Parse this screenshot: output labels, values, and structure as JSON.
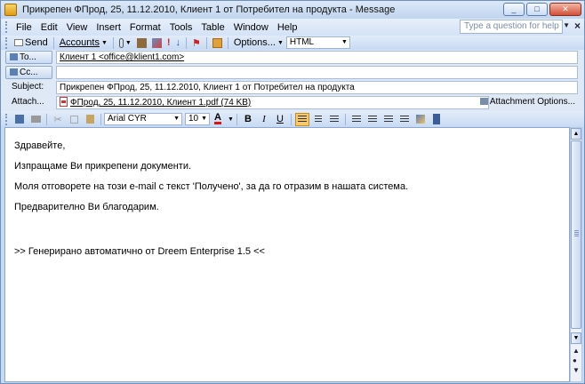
{
  "window": {
    "title": "Прикрепен ФПрод, 25, 11.12.2010, Клиент 1 от Потребител на продукта - Message",
    "controls": [
      "_",
      "□",
      "✕"
    ]
  },
  "menu": {
    "items": [
      "File",
      "Edit",
      "View",
      "Insert",
      "Format",
      "Tools",
      "Table",
      "Window",
      "Help"
    ],
    "help_placeholder": "Type a question for help",
    "help_arrow": "▼",
    "close_doc": "×"
  },
  "toolbar": {
    "send": "Send",
    "accounts": "Accounts",
    "options": "Options...",
    "format": "HTML"
  },
  "header": {
    "to_label": "To...",
    "to_value": "Клиент 1 <office@klient1.com>",
    "cc_label": "Cc...",
    "cc_value": "",
    "subject_label": "Subject:",
    "subject_value": "Прикрепен ФПрод, 25, 11.12.2010, Клиент 1 от Потребител на продукта",
    "attach_label": "Attach...",
    "attach_value": "ФПрод, 25, 11.12.2010, Клиент 1.pdf (74 KB)",
    "attach_options": "Attachment Options..."
  },
  "format_bar": {
    "font": "Arial CYR",
    "size": "10",
    "bold": "B",
    "italic": "I",
    "underline": "U"
  },
  "body": {
    "lines": [
      "Здравейте,",
      "Изпращаме Ви прикрепени документи.",
      "Моля отговорете на този e-mail с текст 'Получено', за да го отразим в нашата система.",
      "Предварително Ви благодарим.",
      ">> Генерирано автоматично от Dreem Enterprise 1.5 <<"
    ]
  }
}
